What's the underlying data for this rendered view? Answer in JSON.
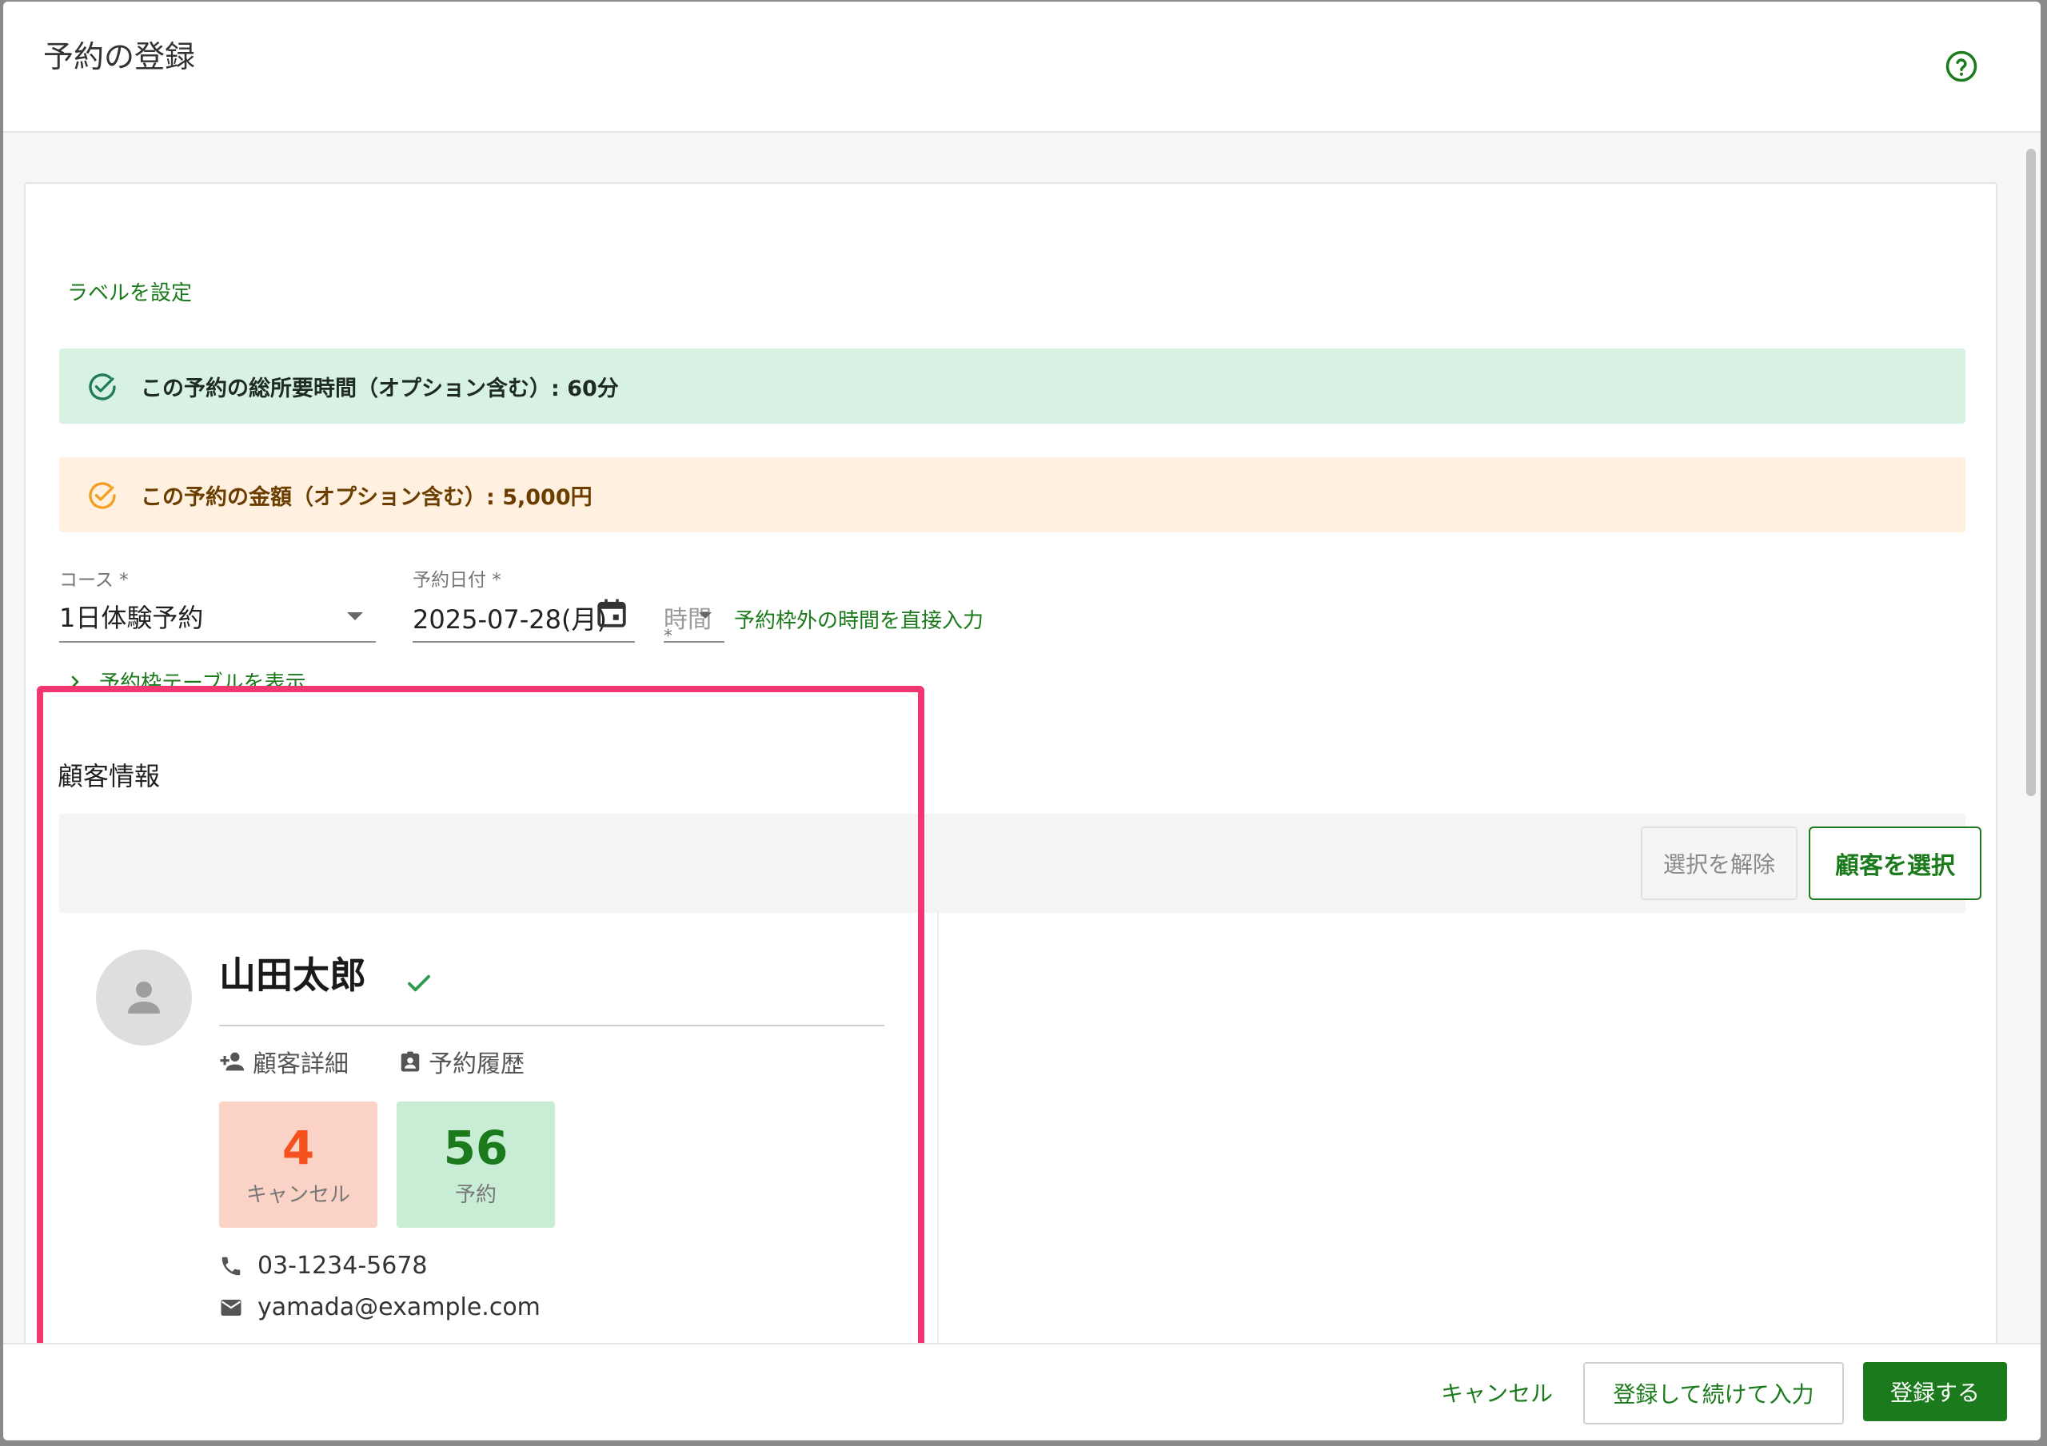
{
  "dialog": {
    "title": "予約の登録",
    "help_icon": "help-circle-icon"
  },
  "label_link": "ラベルを設定",
  "alerts": {
    "duration": "この予約の総所要時間（オプション含む）: 60分",
    "price": "この予約の金額（オプション含む）: 5,000円"
  },
  "form": {
    "course": {
      "label": "コース *",
      "value": "1日体験予約"
    },
    "date": {
      "label": "予約日付 *",
      "value": "2025-07-28(月)"
    },
    "time": {
      "label": "時間",
      "required_mark": "*"
    },
    "direct_input_link": "予約枠外の時間を直接入力",
    "slot_table_toggle": "予約枠テーブルを表示"
  },
  "customer": {
    "section_title": "顧客情報",
    "clear_button": "選択を解除",
    "select_button": "顧客を選択",
    "name": "山田太郎",
    "detail_link": "顧客詳細",
    "history_link": "予約履歴",
    "stats": {
      "cancel_count": "4",
      "cancel_label": "キャンセル",
      "reservation_count": "56",
      "reservation_label": "予約"
    },
    "phone": "03-1234-5678",
    "email": "yamada@example.com"
  },
  "footer": {
    "cancel": "キャンセル",
    "register_continue": "登録して続けて入力",
    "register": "登録する"
  },
  "colors": {
    "accent_green": "#1b7a1b",
    "success_bg": "#d7f2e3",
    "warning_bg": "#fff0df",
    "highlight": "#f2366f",
    "cancel_stat_bg": "#fbd3c6",
    "reservation_stat_bg": "#c9ecd5"
  }
}
